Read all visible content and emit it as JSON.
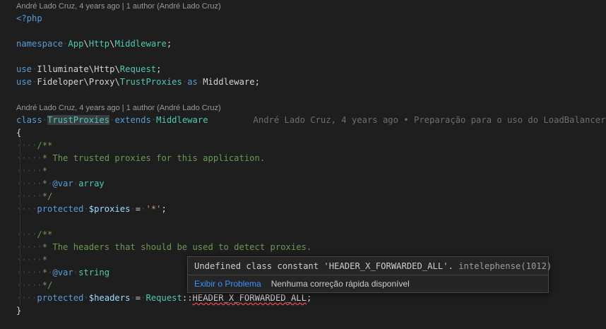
{
  "codelens": {
    "top": "André Lado Cruz, 4 years ago | 1 author (André Lado Cruz)",
    "class": "André Lado Cruz, 4 years ago | 1 author (André Lado Cruz)"
  },
  "code": {
    "php_open": "<?php",
    "namespace_kw": "namespace",
    "namespace_path": [
      "App",
      "Http",
      "Middleware"
    ],
    "use_kw": "use",
    "use1_path": [
      "Illuminate",
      "Http",
      "Request"
    ],
    "use2_path": [
      "Fideloper",
      "Proxy",
      "TrustProxies"
    ],
    "as_kw": "as",
    "alias": "Middleware",
    "class_kw": "class",
    "class_name": "TrustProxies",
    "extends_kw": "extends",
    "parent": "Middleware",
    "blame_inline": "André Lado Cruz, 4 years ago • Preparação para o uso do LoadBalancer",
    "open_brace": "{",
    "close_brace": "}",
    "doc1_line1": "/**",
    "doc1_line2": "* The trusted proxies for this application.",
    "doc_star": "*",
    "doc1_var_tag": "@var",
    "doc1_var_type": "array",
    "doc_end": "*/",
    "protected_kw": "protected",
    "proxies_var": "$proxies",
    "proxies_value": "'*'",
    "doc2_line2": "* The headers that should be used to detect proxies.",
    "doc2_var_type": "string",
    "headers_var": "$headers",
    "request_class": "Request",
    "constant": "HEADER_X_FORWARDED_ALL"
  },
  "hover": {
    "message": "Undefined class constant 'HEADER_X_FORWARDED_ALL'.",
    "source": "intelephense(1012)",
    "view_problem": "Exibir o Problema",
    "no_quick_fix": "Nenhuma correção rápida disponível"
  }
}
